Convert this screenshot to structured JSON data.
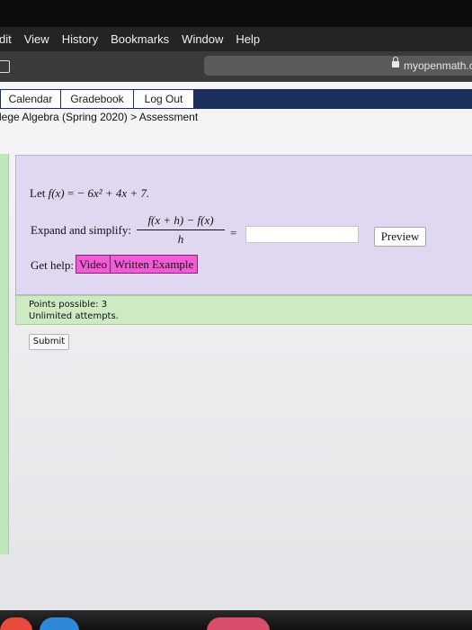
{
  "menubar": {
    "items": [
      "dit",
      "View",
      "History",
      "Bookmarks",
      "Window",
      "Help"
    ]
  },
  "toolbar": {
    "url": "myopenmath.c"
  },
  "nav": {
    "tabs": [
      "Calendar",
      "Gradebook",
      "Log Out"
    ]
  },
  "breadcrumb": {
    "course": "lege Algebra (Spring 2020)",
    "separator": ">",
    "current": "Assessment"
  },
  "question": {
    "let_text": "Let ",
    "func": "f(x)",
    "equals_sign": " = ",
    "expression": "− 6x² + 4x + 7.",
    "expand_label": "Expand and simplify:",
    "numerator": "f(x + h) − f(x)",
    "denominator": "h",
    "equals": "=",
    "answer_value": "",
    "preview_label": "Preview",
    "get_help_label": "Get help:",
    "help_buttons": [
      "Video",
      "Written Example"
    ]
  },
  "points": {
    "possible": "Points possible: 3",
    "attempts": "Unlimited attempts."
  },
  "submit_label": "Submit"
}
